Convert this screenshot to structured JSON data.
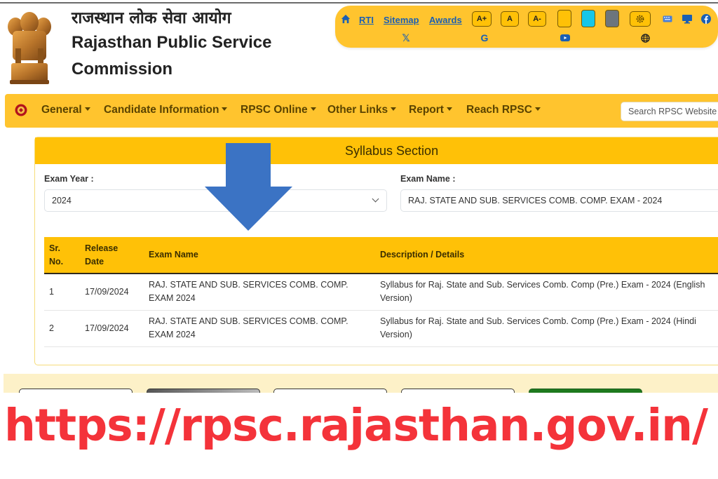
{
  "header": {
    "title_hindi": "राजस्थान लोक सेवा आयोग",
    "title_english_line1": "Rajasthan Public Service",
    "title_english_line2": "Commission",
    "emblem_icon": "national-emblem-icon"
  },
  "utility_bar": {
    "home_icon": "home-icon",
    "links": [
      "RTI",
      "Sitemap",
      "Awards"
    ],
    "font_size_buttons": [
      "A+",
      "A",
      "A-"
    ],
    "theme_swatches": [
      {
        "name": "yellow-theme",
        "color": "#ffc107"
      },
      {
        "name": "cyan-theme",
        "color": "#17c6e8"
      },
      {
        "name": "gray-theme",
        "color": "#6c757d"
      }
    ],
    "settings_icon": "gear-icon",
    "right_icons": [
      "keyboard-icon",
      "desktop-icon",
      "facebook-icon"
    ],
    "social_icons": [
      "x-icon",
      "google-icon",
      "youtube-icon",
      "globe-icon"
    ],
    "accent_color": "#ffc42e",
    "link_color": "#1a5fb4"
  },
  "nav": {
    "logo_icon": "rpsc-logo-icon",
    "items": [
      "General",
      "Candidate Information",
      "RPSC Online",
      "Other Links",
      "Report",
      "Reach RPSC"
    ],
    "search_placeholder": "Search RPSC Website"
  },
  "syllabus": {
    "title": "Syllabus Section",
    "exam_year_label": "Exam Year :",
    "exam_year_value": "2024",
    "exam_name_label": "Exam Name :",
    "exam_name_value": "RAJ. STATE AND SUB. SERVICES COMB. COMP. EXAM - 2024",
    "table": {
      "headers": [
        "Sr. No.",
        "Release Date",
        "Exam Name",
        "Description / Details"
      ],
      "rows": [
        {
          "sr": "1",
          "date": "17/09/2024",
          "exam": "RAJ. STATE AND SUB. SERVICES COMB. COMP. EXAM 2024",
          "desc": "Syllabus for Raj. State and Sub. Services Comb. Comp (Pre.) Exam - 2024 (English Version)"
        },
        {
          "sr": "2",
          "date": "17/09/2024",
          "exam": "RAJ. STATE AND SUB. SERVICES COMB. COMP. EXAM 2024",
          "desc": "Syllabus for Raj. State and Sub. Services Comb. Comp (Pre.) Exam - 2024 (Hindi Version)"
        }
      ]
    }
  },
  "overlay": {
    "arrow_icon": "down-arrow-icon",
    "arrow_color": "#3b73c4",
    "url_text": "https://rpsc.rajasthan.gov.in/",
    "url_color": "#f4333a"
  }
}
